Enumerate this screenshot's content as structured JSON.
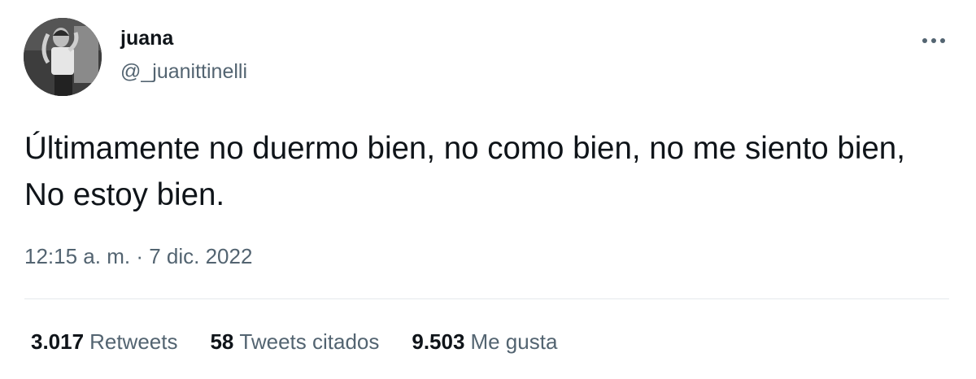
{
  "tweet": {
    "author": {
      "display_name": "juana",
      "handle": "@_juanittinelli",
      "avatar": "profile-photo-bw"
    },
    "more_icon": "ellipsis-icon",
    "text": "Últimamente no duermo bien, no como bien, no me siento bien, No estoy bien.",
    "time": "12:15 a. m.",
    "separator": "·",
    "date": "7 dic. 2022",
    "stats": {
      "retweets_count": "3.017",
      "retweets_label": "Retweets",
      "quotes_count": "58",
      "quotes_label": "Tweets citados",
      "likes_count": "9.503",
      "likes_label": "Me gusta"
    }
  }
}
